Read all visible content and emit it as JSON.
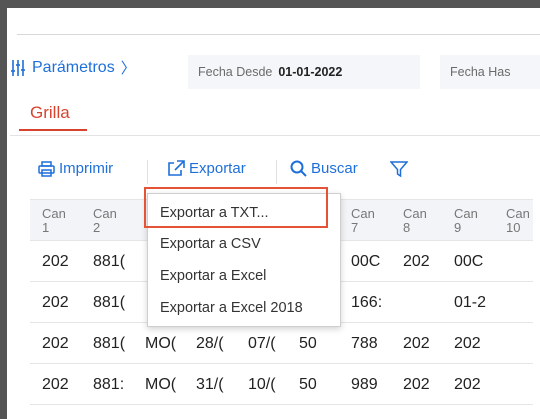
{
  "toolbar_params": {
    "link_label": "Parámetros",
    "chevron": "〉",
    "fecha_desde_label": "Fecha Desde",
    "fecha_desde_value": "01-01-2022",
    "fecha_hasta_label": "Fecha Has"
  },
  "tabs": [
    {
      "label": "Grilla",
      "active": true
    }
  ],
  "actions": {
    "imprimir": "Imprimir",
    "exportar": "Exportar",
    "buscar": "Buscar"
  },
  "grid": {
    "headers": [
      {
        "line1": "Can",
        "line2": "1"
      },
      {
        "line1": "Can",
        "line2": "2"
      },
      {
        "line1": "Can",
        "line2": "7"
      },
      {
        "line1": "Can",
        "line2": "8"
      },
      {
        "line1": "Can",
        "line2": "9"
      },
      {
        "line1": "Can",
        "line2": "10"
      }
    ],
    "rows": [
      [
        "202",
        "881(",
        "",
        "",
        "",
        "",
        "00C",
        "202",
        "00C"
      ],
      [
        "202",
        "881(",
        "",
        "",
        "",
        "",
        "166:",
        "",
        "01-2"
      ],
      [
        "202",
        "881(",
        "MO(",
        "28/(",
        "07/(",
        "50",
        "788",
        "202",
        "202"
      ],
      [
        "202",
        "881:",
        "MO(",
        "31/(",
        "10/(",
        "50",
        "989",
        "202",
        "202"
      ]
    ]
  },
  "export_menu": {
    "items": [
      "Exportar a TXT...",
      "Exportar a CSV",
      "Exportar a Excel",
      "Exportar a Excel 2018"
    ]
  },
  "colors": {
    "accent_blue": "#1e6fd9",
    "tab_red": "#d8432f",
    "highlight": "#e55337"
  }
}
